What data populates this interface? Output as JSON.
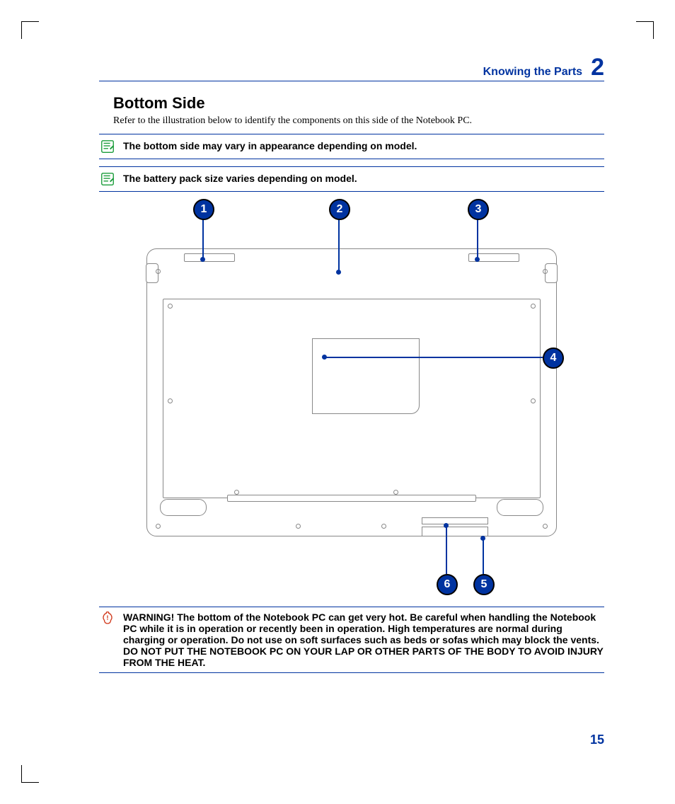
{
  "header": {
    "section_title": "Knowing the Parts",
    "chapter_number": "2"
  },
  "section": {
    "title": "Bottom Side",
    "subtitle": "Refer to the illustration below to identify the components on this side of the Notebook PC."
  },
  "notes": [
    "The bottom side may vary in appearance depending on model.",
    "The battery pack size varies depending on model."
  ],
  "callouts": {
    "c1": "1",
    "c2": "2",
    "c3": "3",
    "c4": "4",
    "c5": "5",
    "c6": "6"
  },
  "warning": "WARNING!  The bottom of the Notebook PC can get very hot. Be careful when handling the Notebook PC while it is in operation or recently been in operation. High temperatures are normal during charging or operation. Do not use on soft surfaces such as beds or sofas which may block the vents. DO NOT PUT THE NOTEBOOK PC ON YOUR LAP OR OTHER PARTS OF THE BODY TO AVOID INJURY FROM THE HEAT.",
  "page_number": "15"
}
